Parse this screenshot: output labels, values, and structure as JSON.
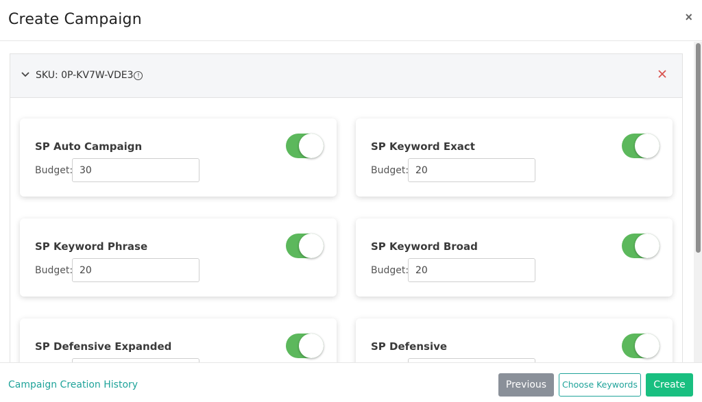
{
  "modal": {
    "title": "Create Campaign",
    "close_icon": "×"
  },
  "sku": {
    "label": "SKU: 0P-KV7W-VDE3",
    "info_icon": "!"
  },
  "budget_label": "Budget:",
  "campaigns": [
    {
      "name": "SP Auto Campaign",
      "budget": "30",
      "enabled": true
    },
    {
      "name": "SP Keyword Exact",
      "budget": "20",
      "enabled": true
    },
    {
      "name": "SP Keyword Phrase",
      "budget": "20",
      "enabled": true
    },
    {
      "name": "SP Keyword Broad",
      "budget": "20",
      "enabled": true
    },
    {
      "name": "SP Defensive Expanded",
      "budget": "",
      "enabled": true
    },
    {
      "name": "SP Defensive",
      "budget": "",
      "enabled": true
    }
  ],
  "footer": {
    "history_link": "Campaign Creation History",
    "previous_label": "Previous",
    "choose_keywords_label": "Choose Keywords",
    "create_label": "Create"
  },
  "colors": {
    "toggle_on": "#5cb85c",
    "accent_teal": "#1fa39a",
    "create_green": "#19bf80",
    "remove_red": "#d9534f"
  }
}
